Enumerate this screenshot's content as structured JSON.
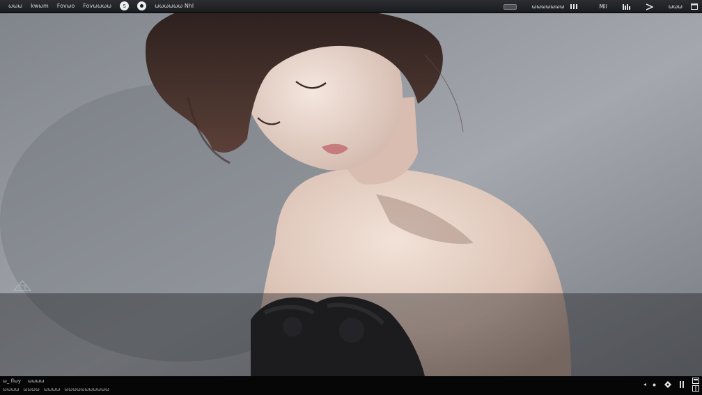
{
  "menu": {
    "items": [
      "ωωω",
      "kwωm",
      "Fovωo",
      "Fovωωωω"
    ],
    "round_button_label": "S"
  },
  "toolbar": {
    "mode_label": "ωωωωωω Nhl",
    "right_label_1": "ωωωωωωω",
    "right_label_2": "Mil",
    "right_label_3": "ωωω"
  },
  "status": {
    "left_row1": [
      "ω_ flωy",
      "ωωωω"
    ],
    "left_row2": [
      "ωωωω",
      "ωωωω",
      "ωωωω",
      "ωωωωωωωωωωω"
    ]
  },
  "icons": {
    "round_button": "circle-button",
    "record_button": "record-icon",
    "toggle": "toggle-icon",
    "grid": "grid-icon",
    "bars": "bars-icon",
    "play": "play-icon",
    "window": "window-icon",
    "diamond": "diamond-icon",
    "fullscreen": "fullscreen-icon"
  },
  "colors": {
    "toolbar_bg": "#1c1d20",
    "status_bg": "#060607",
    "canvas_bg": "#8c9097"
  }
}
